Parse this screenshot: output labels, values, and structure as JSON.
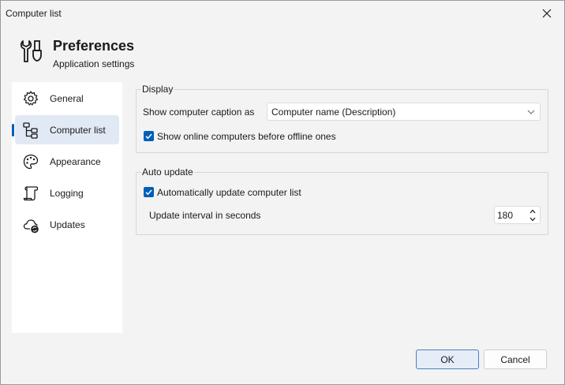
{
  "window": {
    "title": "Computer list"
  },
  "header": {
    "title": "Preferences",
    "subtitle": "Application settings",
    "icon": "tools-icon"
  },
  "sidebar": {
    "items": [
      {
        "label": "General",
        "icon": "gear-icon",
        "selected": false
      },
      {
        "label": "Computer list",
        "icon": "tree-icon",
        "selected": true
      },
      {
        "label": "Appearance",
        "icon": "palette-icon",
        "selected": false
      },
      {
        "label": "Logging",
        "icon": "scroll-icon",
        "selected": false
      },
      {
        "label": "Updates",
        "icon": "cloud-sync-icon",
        "selected": false
      }
    ]
  },
  "display": {
    "title": "Display",
    "caption_label": "Show computer caption as",
    "caption_value": "Computer name (Description)",
    "online_first_label": "Show online computers before offline ones",
    "online_first_checked": true
  },
  "auto_update": {
    "title": "Auto update",
    "auto_label": "Automatically update computer list",
    "auto_checked": true,
    "interval_label": "Update interval in seconds",
    "interval_value": "180"
  },
  "buttons": {
    "ok": "OK",
    "cancel": "Cancel"
  },
  "colors": {
    "accent": "#005fb8",
    "selected_bg": "#e1e9f5",
    "window_bg": "#f3f3f3"
  }
}
